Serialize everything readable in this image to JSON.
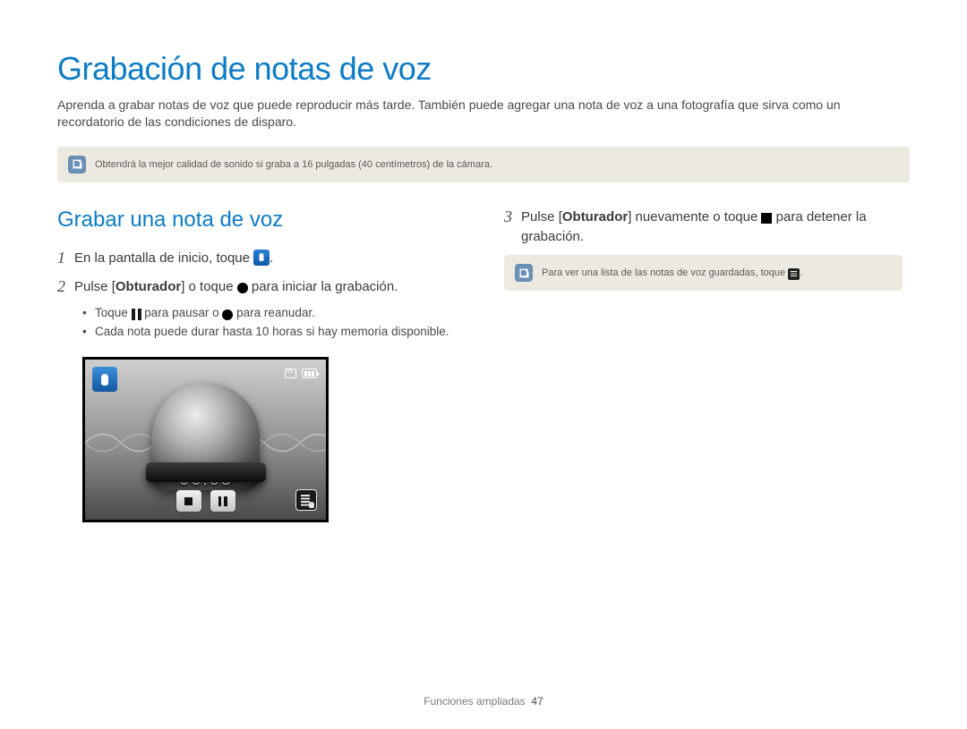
{
  "title": "Grabación de notas de voz",
  "intro": "Aprenda a grabar notas de voz que puede reproducir más tarde. También puede agregar una nota de voz a una fotografía que sirva como un recordatorio de las condiciones de disparo.",
  "note_top": "Obtendrá la mejor calidad de sonido si graba a 16 pulgadas (40 centímetros) de la cámara.",
  "section_title": "Grabar una nota de voz",
  "steps": {
    "s1_pre": "En la pantalla de inicio, toque ",
    "s1_post": ".",
    "s2_pre": "Pulse [",
    "s2_bold": "Obturador",
    "s2_mid": "] o toque ",
    "s2_post": " para iniciar la grabación.",
    "s3_pre": "Pulse [",
    "s3_bold": "Obturador",
    "s3_mid": "] nuevamente o toque ",
    "s3_post": " para detener la grabación."
  },
  "bullets": {
    "b1_pre": "Toque ",
    "b1_mid": " para pausar o ",
    "b1_post": " para reanudar.",
    "b2": "Cada nota puede durar hasta 10 horas si hay memoria disponible."
  },
  "note_right_pre": "Para ver una lista de las notas de voz guardadas, toque ",
  "note_right_post": ".",
  "timer": "00:05",
  "footer_section": "Funciones ampliadas",
  "footer_page": "47",
  "nums": {
    "n1": "1",
    "n2": "2",
    "n3": "3"
  }
}
